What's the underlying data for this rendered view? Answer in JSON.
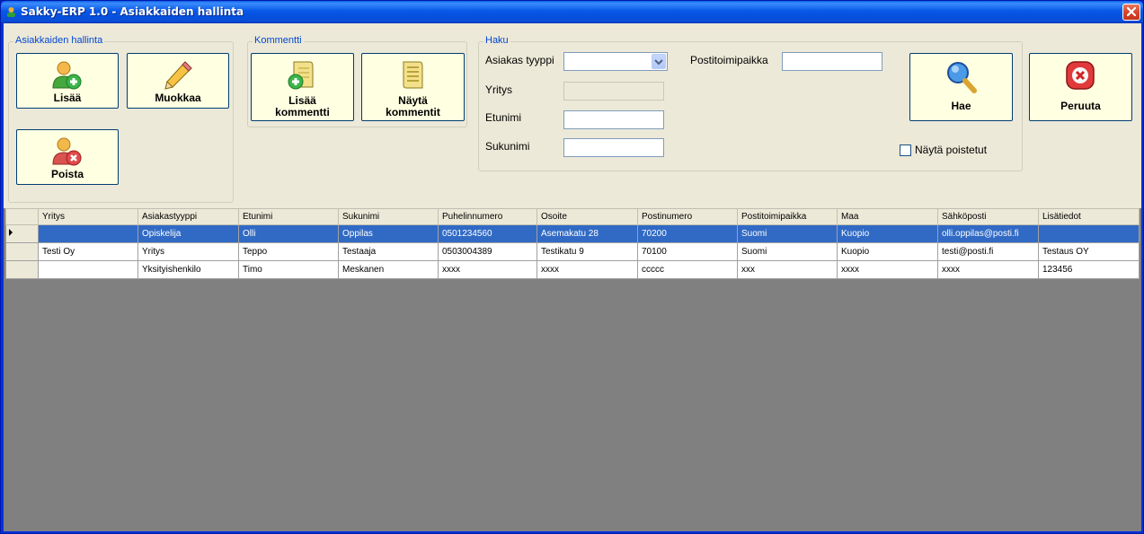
{
  "window": {
    "title": "Sakky-ERP 1.0 - Asiakkaiden hallinta"
  },
  "groups": {
    "customers": {
      "title": "Asiakkaiden hallinta",
      "add_label": "Lisää",
      "edit_label": "Muokkaa",
      "delete_label": "Poista"
    },
    "comments": {
      "title": "Kommentti",
      "add_label_1": "Lisää",
      "add_label_2": "kommentti",
      "show_label_1": "Näytä",
      "show_label_2": "kommentit"
    },
    "search": {
      "title": "Haku",
      "customer_type_label": "Asiakas tyyppi",
      "customer_type_value": "",
      "company_label": "Yritys",
      "company_value": "",
      "firstname_label": "Etunimi",
      "firstname_value": "",
      "lastname_label": "Sukunimi",
      "lastname_value": "",
      "city_label": "Postitoimipaikka",
      "city_value": "",
      "show_deleted_label": "Näytä poistetut",
      "show_deleted_checked": false
    }
  },
  "actions": {
    "search_label": "Hae",
    "cancel_label": "Peruuta"
  },
  "grid": {
    "columns": [
      "Yritys",
      "Asiakastyyppi",
      "Etunimi",
      "Sukunimi",
      "Puhelinnumero",
      "Osoite",
      "Postinumero",
      "Postitoimipaikka",
      "Maa",
      "Sähköposti",
      "Lisätiedot"
    ],
    "rows": [
      [
        "",
        "Opiskelija",
        "Olli",
        "Oppilas",
        "0501234560",
        "Asemakatu 28",
        "70200",
        "Suomi",
        "Kuopio",
        "olli.oppilas@posti.fi",
        ""
      ],
      [
        "Testi Oy",
        "Yritys",
        "Teppo",
        "Testaaja",
        "0503004389",
        "Testikatu 9",
        "70100",
        "Suomi",
        "Kuopio",
        "testi@posti.fi",
        "Testaus OY"
      ],
      [
        "",
        "Yksityishenkilo",
        "Timo",
        "Meskanen",
        "xxxx",
        "xxxx",
        "ccccc",
        "xxx",
        "xxxx",
        "xxxx",
        "123456"
      ]
    ],
    "selected_row": 0
  },
  "icons": {
    "app": "app-icon",
    "close": "close-icon",
    "add_user": "user-add-icon",
    "edit": "pencil-icon",
    "delete_user": "user-delete-icon",
    "add_comment": "note-add-icon",
    "show_comments": "note-icon",
    "search": "magnifier-icon",
    "cancel": "cancel-icon",
    "combo": "chevron-down-icon",
    "row_pointer": "row-pointer-icon"
  }
}
